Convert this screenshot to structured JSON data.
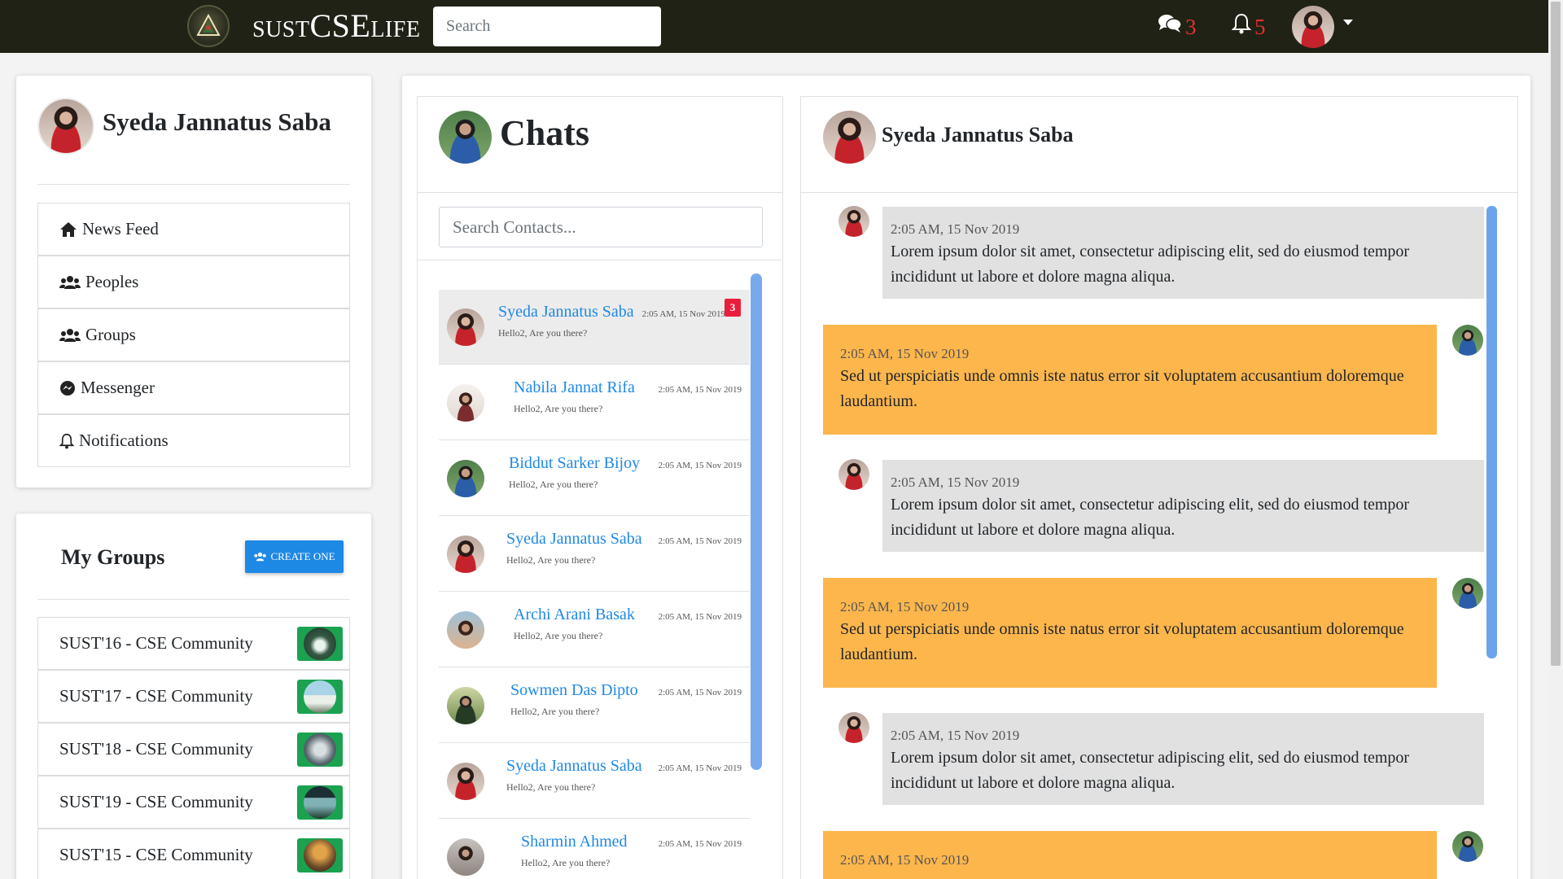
{
  "topbar": {
    "brand_prefix": "SUST",
    "brand_middle": "CSE",
    "brand_suffix": "LIFE",
    "search_placeholder": "Search",
    "messages_count": "3",
    "notifications_count": "5"
  },
  "profile": {
    "name": "Syeda Jannatus Saba"
  },
  "nav": {
    "items": [
      {
        "label": "News Feed",
        "icon": "home-icon"
      },
      {
        "label": "Peoples",
        "icon": "users-icon"
      },
      {
        "label": "Groups",
        "icon": "users-icon"
      },
      {
        "label": "Messenger",
        "icon": "messenger-icon"
      },
      {
        "label": "Notifications",
        "icon": "bell-icon"
      }
    ]
  },
  "groups": {
    "title": "My Groups",
    "create_label": "CREATE ONE",
    "items": [
      {
        "label": "SUST'16 - CSE Community"
      },
      {
        "label": "SUST'17 - CSE Community"
      },
      {
        "label": "SUST'18 - CSE Community"
      },
      {
        "label": "SUST'19 - CSE Community"
      },
      {
        "label": "SUST'15 - CSE Community"
      }
    ]
  },
  "chats": {
    "title": "Chats",
    "search_placeholder": "Search Contacts...",
    "unread_badge": "3",
    "contacts": [
      {
        "name": "Syeda Jannatus Saba",
        "time": "2:05 AM, 15 Nov 2019",
        "message": "Hello2, Are you there?"
      },
      {
        "name": "Nabila Jannat Rifa",
        "time": "2:05 AM, 15 Nov 2019",
        "message": "Hello2, Are you there?"
      },
      {
        "name": "Biddut Sarker Bijoy",
        "time": "2:05 AM, 15 Nov 2019",
        "message": "Hello2, Are you there?"
      },
      {
        "name": "Syeda Jannatus Saba",
        "time": "2:05 AM, 15 Nov 2019",
        "message": "Hello2, Are you there?"
      },
      {
        "name": "Archi Arani Basak",
        "time": "2:05 AM, 15 Nov 2019",
        "message": "Hello2, Are you there?"
      },
      {
        "name": "Sowmen Das Dipto",
        "time": "2:05 AM, 15 Nov 2019",
        "message": "Hello2, Are you there?"
      },
      {
        "name": "Syeda Jannatus Saba",
        "time": "2:05 AM, 15 Nov 2019",
        "message": "Hello2, Are you there?"
      },
      {
        "name": "Sharmin Ahmed",
        "time": "2:05 AM, 15 Nov 2019",
        "message": "Hello2, Are you there?"
      }
    ]
  },
  "conversation": {
    "name": "Syeda Jannatus Saba",
    "messages": [
      {
        "time": "2:05 AM, 15 Nov 2019",
        "text": "Lorem ipsum dolor sit amet, consectetur adipiscing elit, sed do eiusmod tempor incididunt ut labore et dolore magna aliqua."
      },
      {
        "time": "2:05 AM, 15 Nov 2019",
        "text": "Sed ut perspiciatis unde omnis iste natus error sit voluptatem accusantium doloremque laudantium."
      },
      {
        "time": "2:05 AM, 15 Nov 2019",
        "text": "Lorem ipsum dolor sit amet, consectetur adipiscing elit, sed do eiusmod tempor incididunt ut labore et dolore magna aliqua."
      },
      {
        "time": "2:05 AM, 15 Nov 2019",
        "text": "Sed ut perspiciatis unde omnis iste natus error sit voluptatem accusantium doloremque laudantium."
      },
      {
        "time": "2:05 AM, 15 Nov 2019",
        "text": "Lorem ipsum dolor sit amet, consectetur adipiscing elit, sed do eiusmod tempor incididunt ut labore et dolore magna aliqua."
      },
      {
        "time": "2:05 AM, 15 Nov 2019",
        "text": ""
      }
    ]
  },
  "colors": {
    "topbar_bg": "#1f2215",
    "accent_blue": "#1e88e5",
    "outgoing_bubble": "#fdb64c",
    "incoming_bubble": "#e1e1e1",
    "badge_red": "#e91e3c",
    "count_red": "#e3312f"
  }
}
